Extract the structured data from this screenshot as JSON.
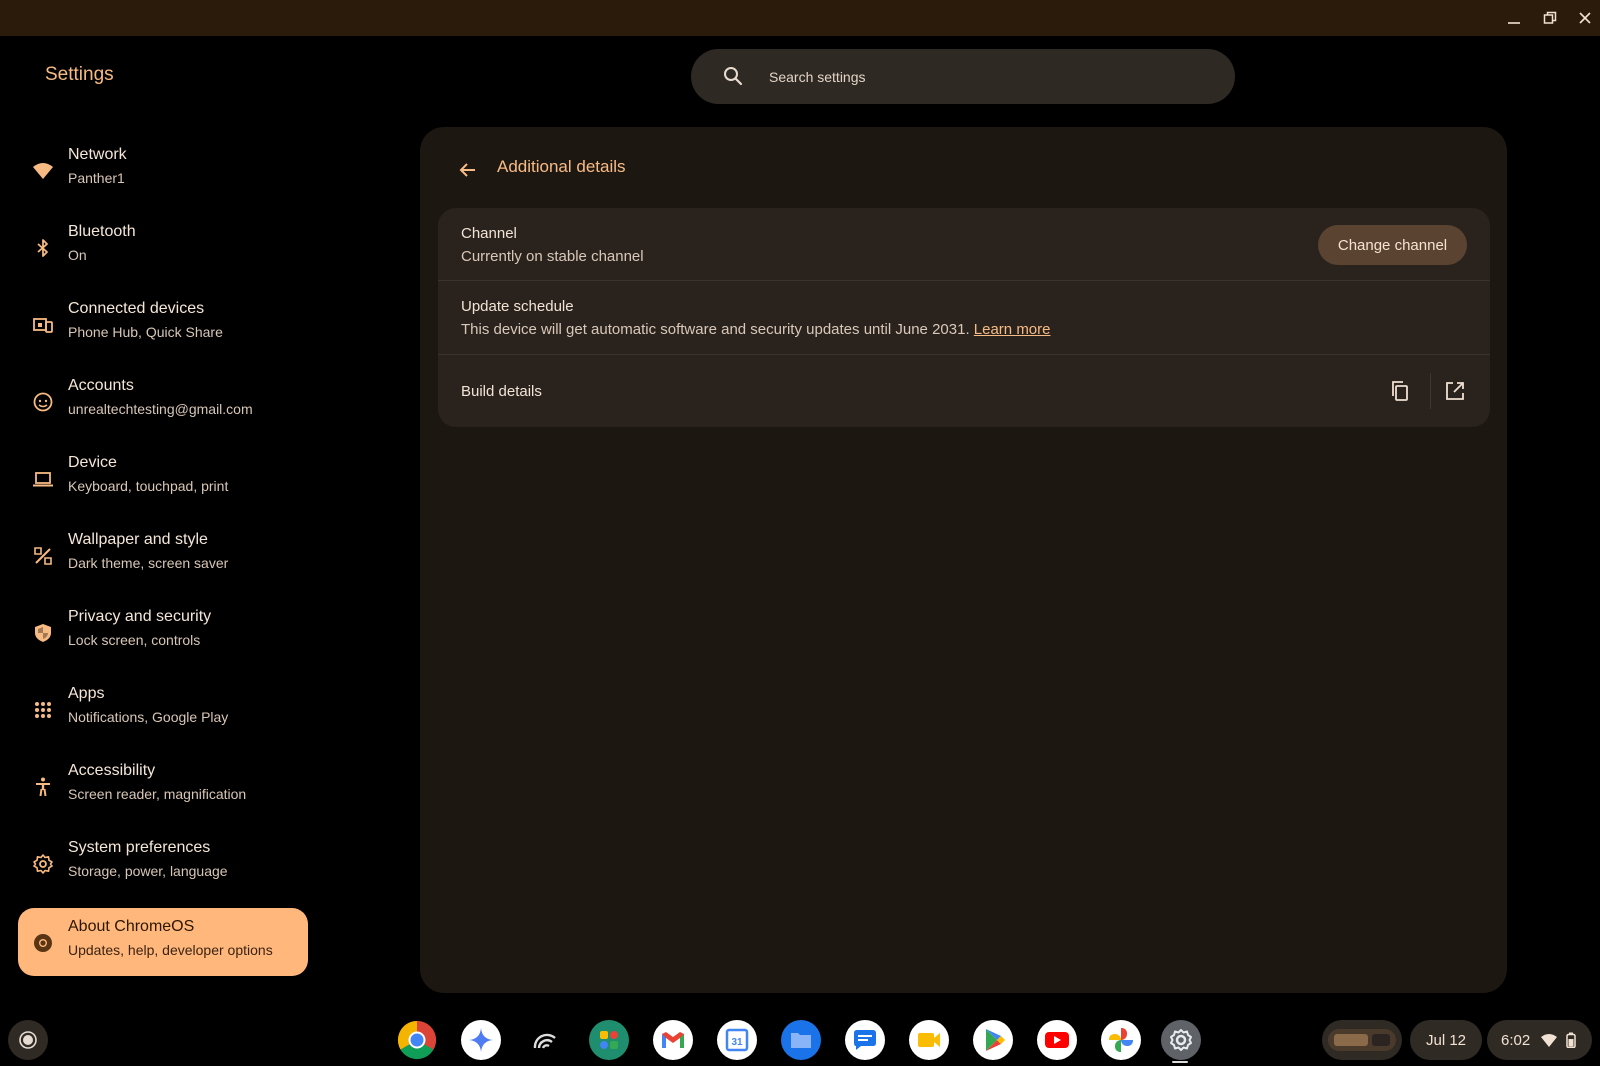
{
  "app": {
    "title": "Settings"
  },
  "search": {
    "placeholder": "Search settings"
  },
  "sidebar": {
    "items": [
      {
        "title": "Network",
        "subtitle": "Panther1",
        "icon": "wifi-icon"
      },
      {
        "title": "Bluetooth",
        "subtitle": "On",
        "icon": "bluetooth-icon"
      },
      {
        "title": "Connected devices",
        "subtitle": "Phone Hub, Quick Share",
        "icon": "connected-devices-icon"
      },
      {
        "title": "Accounts",
        "subtitle": "unrealtechtesting@gmail.com",
        "icon": "accounts-icon"
      },
      {
        "title": "Device",
        "subtitle": "Keyboard, touchpad, print",
        "icon": "laptop-icon"
      },
      {
        "title": "Wallpaper and style",
        "subtitle": "Dark theme, screen saver",
        "icon": "palette-brush-icon"
      },
      {
        "title": "Privacy and security",
        "subtitle": "Lock screen, controls",
        "icon": "shield-icon"
      },
      {
        "title": "Apps",
        "subtitle": "Notifications, Google Play",
        "icon": "apps-grid-icon"
      },
      {
        "title": "Accessibility",
        "subtitle": "Screen reader, magnification",
        "icon": "accessibility-icon"
      },
      {
        "title": "System preferences",
        "subtitle": "Storage, power, language",
        "icon": "gear-icon"
      },
      {
        "title": "About ChromeOS",
        "subtitle": "Updates, help, developer options",
        "icon": "chromeos-icon",
        "selected": true
      }
    ]
  },
  "main": {
    "title": "Additional details",
    "channel": {
      "title": "Channel",
      "subtitle": "Currently on stable channel",
      "button": "Change channel"
    },
    "update_schedule": {
      "title": "Update schedule",
      "text": "This device will get automatic software and security updates until June 2031.",
      "link": "Learn more"
    },
    "build_details": {
      "title": "Build details"
    }
  },
  "shelf": {
    "apps": [
      "chrome-icon",
      "gemini-icon",
      "podcast-icon",
      "google-apps-icon",
      "gmail-icon",
      "calendar-icon",
      "files-icon",
      "messages-icon",
      "meet-icon",
      "play-store-icon",
      "youtube-icon",
      "photos-icon",
      "settings-icon"
    ],
    "calendar_day": "31",
    "date": "Jul 12",
    "time": "6:02"
  },
  "colors": {
    "accent": "#ffb77c",
    "panel": "#1d1712",
    "card": "#2a231d",
    "titlebar": "#2b1b0a"
  }
}
